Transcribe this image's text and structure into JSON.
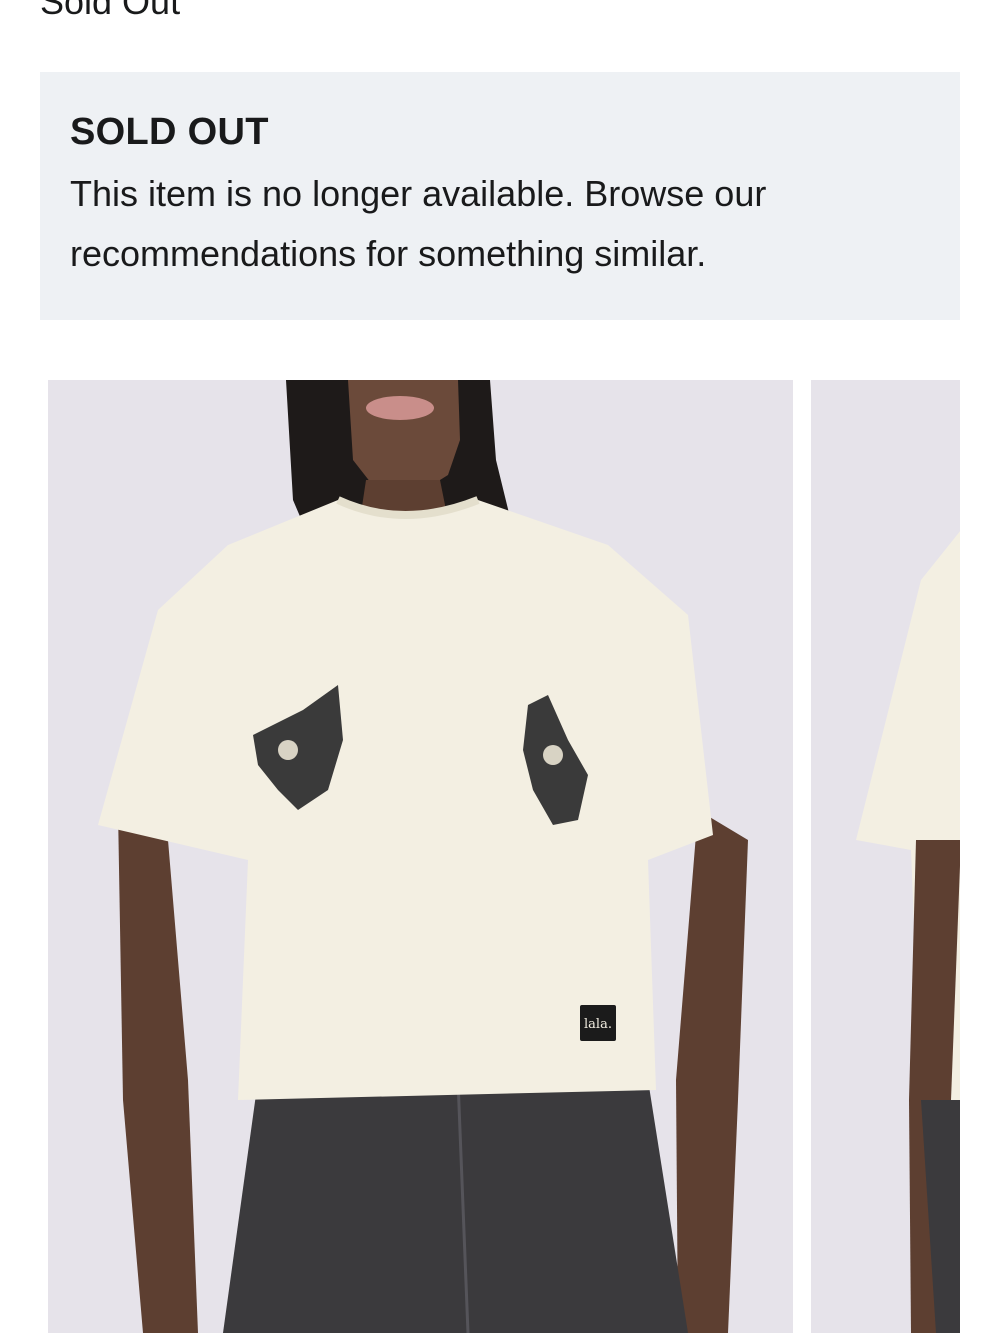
{
  "status": {
    "label": "Sold Out"
  },
  "notice": {
    "title": "SOLD OUT",
    "message": "This item is no longer available. Browse our recommendations for something similar."
  },
  "gallery": {
    "images": [
      {
        "subject": "Model wearing cream cropped t-shirt with two cat face prints and dark jeans, front view"
      },
      {
        "subject": "Model wearing cream cropped t-shirt, side view"
      }
    ],
    "tag_text": "lala."
  },
  "colors": {
    "notice_background": "#eef1f4",
    "text": "#191a1b",
    "photo_background": "#e6e3ea",
    "shirt": "#f3efe2"
  }
}
